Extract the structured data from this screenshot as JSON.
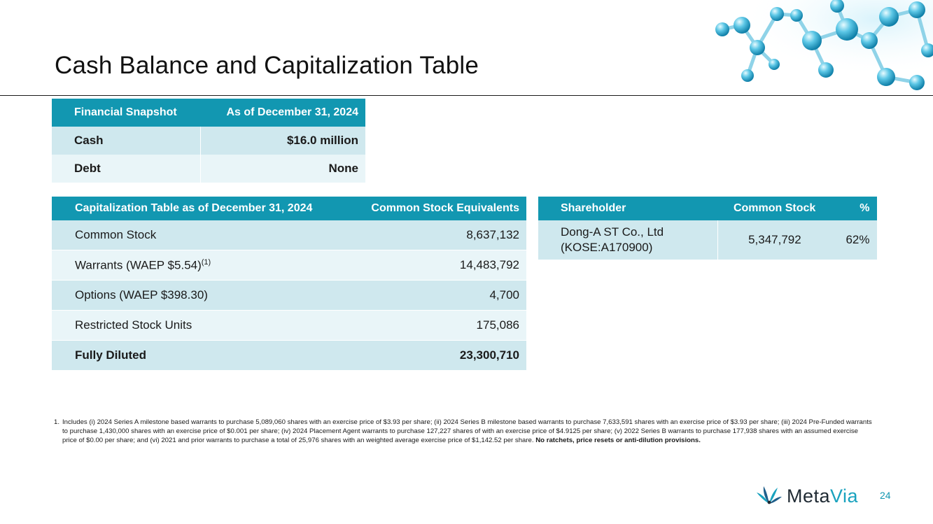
{
  "title": "Cash Balance and Capitalization Table",
  "snapshot": {
    "headers": [
      "Financial Snapshot",
      "As of December 31, 2024"
    ],
    "rows": [
      {
        "label": "Cash",
        "value": "$16.0 million"
      },
      {
        "label": "Debt",
        "value": "None"
      }
    ]
  },
  "cap_table": {
    "headers": [
      "Capitalization Table as of December 31, 2024",
      "Common Stock Equivalents"
    ],
    "rows": [
      {
        "label": "Common Stock",
        "value": "8,637,132"
      },
      {
        "label": "Warrants (WAEP $5.54)",
        "sup": "(1)",
        "value": "14,483,792"
      },
      {
        "label": "Options (WAEP $398.30)",
        "value": "4,700"
      },
      {
        "label": "Restricted Stock Units",
        "value": "175,086"
      },
      {
        "label": "Fully Diluted",
        "value": "23,300,710"
      }
    ]
  },
  "shareholder_table": {
    "headers": [
      "Shareholder",
      "Common Stock",
      "%"
    ],
    "rows": [
      {
        "name_line1": "Dong-A ST Co., Ltd",
        "name_line2": "(KOSE:A170900)",
        "shares": "5,347,792",
        "pct": "62%"
      }
    ]
  },
  "footnote": {
    "number": "1.",
    "text": "Includes (i) 2024 Series A milestone based warrants to purchase 5,089,060 shares with an exercise price of $3.93 per share; (ii) 2024 Series B milestone based warrants to purchase 7,633,591 shares with an exercise price of $3.93 per share; (iii) 2024 Pre-Funded warrants to purchase 1,430,000 shares with an exercise price of $0.001 per share; (iv) 2024 Placement Agent warrants to purchase 127,227 shares of with an exercise price of $4.9125 per share; (v) 2022 Series B warrants to purchase 177,938 shares with an assumed exercise price of $0.00 per share; and (vi) 2021 and prior warrants to purchase a total of 25,976 shares with an weighted average exercise price of $1,142.52 per share.",
    "bold": "No ratchets, price resets or anti-dilution provisions."
  },
  "logo": {
    "part1": "Meta",
    "part2": "Via"
  },
  "page_number": "24",
  "colors": {
    "header": "#1297b1",
    "row_dark": "#cfe8ee",
    "row_light": "#e9f5f8",
    "brand": "#19a2be"
  }
}
